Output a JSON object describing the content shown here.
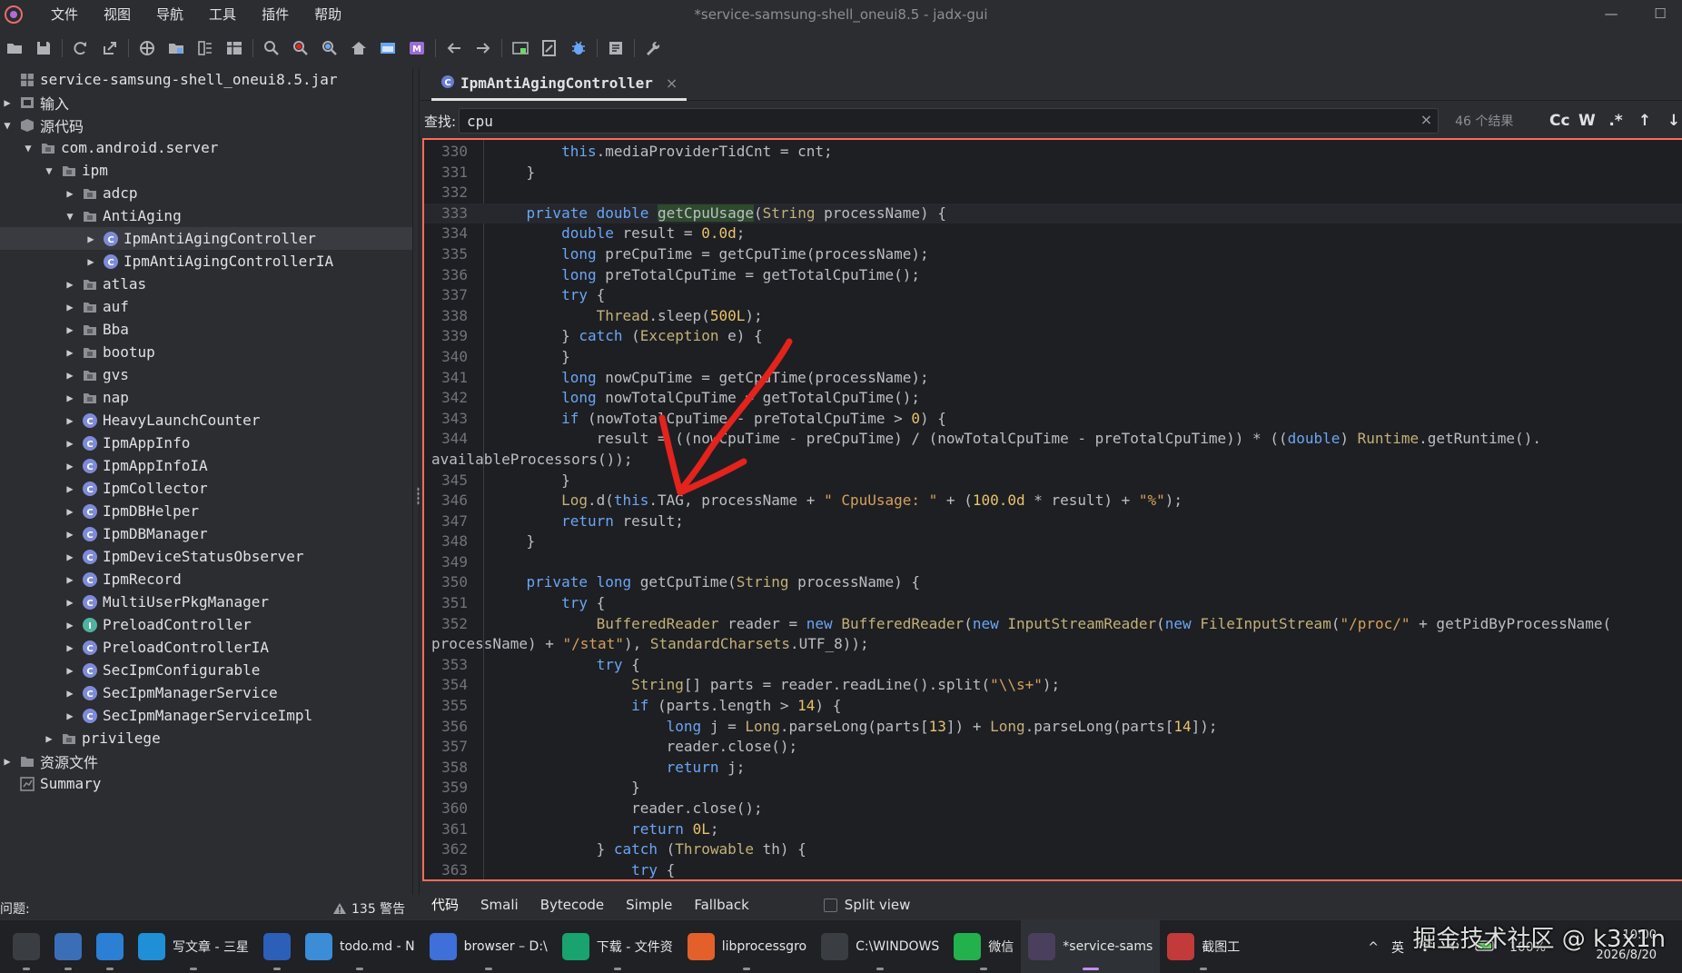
{
  "window": {
    "title": "*service-samsung-shell_oneui8.5 - jadx-gui",
    "menu": [
      "文件",
      "视图",
      "导航",
      "工具",
      "插件",
      "帮助"
    ],
    "minimize": "—",
    "maximize": "☐"
  },
  "toolbar": {
    "icons": [
      "open-icon",
      "save-icon",
      "reload-icon",
      "export-icon",
      "sync-icon",
      "folder-icon",
      "flatten-icon",
      "table-icon",
      "search-icon",
      "search-class-icon",
      "search-usage-icon",
      "home-icon",
      "window-icon",
      "bookmark-m-icon",
      "back-icon",
      "forward-icon",
      "deobfuscate-icon",
      "open-file-icon",
      "debug-icon",
      "log-icon",
      "settings-icon"
    ]
  },
  "tree": {
    "rows": [
      {
        "label": "service-samsung-shell_oneui8.5.jar",
        "depth": 0,
        "toggle": "",
        "icon": "jar-icon"
      },
      {
        "label": "输入",
        "depth": 0,
        "toggle": "▶",
        "icon": "input-icon"
      },
      {
        "label": "源代码",
        "depth": 0,
        "toggle": "▼",
        "icon": "source-icon"
      },
      {
        "label": "com.android.server",
        "depth": 1,
        "toggle": "▼",
        "icon": "package-icon"
      },
      {
        "label": "ipm",
        "depth": 2,
        "toggle": "▼",
        "icon": "package-icon"
      },
      {
        "label": "adcp",
        "depth": 3,
        "toggle": "▶",
        "icon": "package-icon"
      },
      {
        "label": "AntiAging",
        "depth": 3,
        "toggle": "▼",
        "icon": "package-icon"
      },
      {
        "label": "IpmAntiAgingController",
        "depth": 4,
        "toggle": "▶",
        "icon": "class-icon",
        "selected": true
      },
      {
        "label": "IpmAntiAgingControllerIA",
        "depth": 4,
        "toggle": "▶",
        "icon": "class-icon"
      },
      {
        "label": "atlas",
        "depth": 3,
        "toggle": "▶",
        "icon": "package-icon"
      },
      {
        "label": "auf",
        "depth": 3,
        "toggle": "▶",
        "icon": "package-icon"
      },
      {
        "label": "Bba",
        "depth": 3,
        "toggle": "▶",
        "icon": "package-icon"
      },
      {
        "label": "bootup",
        "depth": 3,
        "toggle": "▶",
        "icon": "package-icon"
      },
      {
        "label": "gvs",
        "depth": 3,
        "toggle": "▶",
        "icon": "package-icon"
      },
      {
        "label": "nap",
        "depth": 3,
        "toggle": "▶",
        "icon": "package-icon"
      },
      {
        "label": "HeavyLaunchCounter",
        "depth": 3,
        "toggle": "▶",
        "icon": "class-icon"
      },
      {
        "label": "IpmAppInfo",
        "depth": 3,
        "toggle": "▶",
        "icon": "class-icon"
      },
      {
        "label": "IpmAppInfoIA",
        "depth": 3,
        "toggle": "▶",
        "icon": "class-icon"
      },
      {
        "label": "IpmCollector",
        "depth": 3,
        "toggle": "▶",
        "icon": "class-icon"
      },
      {
        "label": "IpmDBHelper",
        "depth": 3,
        "toggle": "▶",
        "icon": "class-icon"
      },
      {
        "label": "IpmDBManager",
        "depth": 3,
        "toggle": "▶",
        "icon": "class-icon"
      },
      {
        "label": "IpmDeviceStatusObserver",
        "depth": 3,
        "toggle": "▶",
        "icon": "class-icon"
      },
      {
        "label": "IpmRecord",
        "depth": 3,
        "toggle": "▶",
        "icon": "class-icon"
      },
      {
        "label": "MultiUserPkgManager",
        "depth": 3,
        "toggle": "▶",
        "icon": "class-icon"
      },
      {
        "label": "PreloadController",
        "depth": 3,
        "toggle": "▶",
        "icon": "interface-icon"
      },
      {
        "label": "PreloadControllerIA",
        "depth": 3,
        "toggle": "▶",
        "icon": "class-icon"
      },
      {
        "label": "SecIpmConfigurable",
        "depth": 3,
        "toggle": "▶",
        "icon": "class-icon"
      },
      {
        "label": "SecIpmManagerService",
        "depth": 3,
        "toggle": "▶",
        "icon": "class-icon"
      },
      {
        "label": "SecIpmManagerServiceImpl",
        "depth": 3,
        "toggle": "▶",
        "icon": "class-icon"
      },
      {
        "label": "privilege",
        "depth": 2,
        "toggle": "▶",
        "icon": "package-icon"
      },
      {
        "label": "资源文件",
        "depth": 0,
        "toggle": "▶",
        "icon": "resources-icon"
      },
      {
        "label": "Summary",
        "depth": 0,
        "toggle": "",
        "icon": "summary-icon"
      }
    ]
  },
  "editor": {
    "tab_label": "IpmAntiAgingController",
    "tab_close": "×"
  },
  "search": {
    "label": "查找:",
    "value": "cpu",
    "clear": "×",
    "result_count": "46 个结果",
    "opt_case": "Cc",
    "opt_word": "W",
    "opt_regex": ".*",
    "prev": "↑",
    "next": "↓"
  },
  "code": {
    "lines": [
      {
        "n": "330",
        "t": "        <k>this</k>.mediaProviderTidCnt = cnt;"
      },
      {
        "n": "331",
        "t": "    }"
      },
      {
        "n": "332",
        "t": ""
      },
      {
        "n": "333",
        "t": "    <k>private</k> <k>double</k> <h>getCpuUsage</h>(<y>String</y> processName) {",
        "cur": true
      },
      {
        "n": "334",
        "t": "        <k>double</k> result = <m>0.0d</m>;"
      },
      {
        "n": "335",
        "t": "        <k>long</k> preCpuTime = getCpuTime(processName);"
      },
      {
        "n": "336",
        "t": "        <k>long</k> preTotalCpuTime = getTotalCpuTime();"
      },
      {
        "n": "337",
        "t": "        <k>try</k> {"
      },
      {
        "n": "338",
        "t": "            <y>Thread</y>.sleep(<m>500L</m>);"
      },
      {
        "n": "339",
        "t": "        } <k>catch</k> (<y>Exception</y> e) {"
      },
      {
        "n": "340",
        "t": "        }"
      },
      {
        "n": "341",
        "t": "        <k>long</k> nowCpuTime = getCpuTime(processName);"
      },
      {
        "n": "342",
        "t": "        <k>long</k> nowTotalCpuTime = getTotalCpuTime();"
      },
      {
        "n": "343",
        "t": "        <k>if</k> (nowTotalCpuTime - preTotalCpuTime > <m>0</m>) {"
      },
      {
        "n": "344",
        "t": "            result = ((nowCpuTime - preCpuTime) / (nowTotalCpuTime - preTotalCpuTime)) * ((<k>double</k>) <y>Runtime</y>.getRuntime()."
      },
      {
        "n": "",
        "t": "availableProcessors());",
        "wrap": true
      },
      {
        "n": "345",
        "t": "        }"
      },
      {
        "n": "346",
        "t": "        <y>Log</y>.d(<k>this</k>.TAG, processName + <s>\" CpuUsage: \"</s> + (<m>100.0d</m> * result) + <s>\"%\"</s>);"
      },
      {
        "n": "347",
        "t": "        <k>return</k> result;"
      },
      {
        "n": "348",
        "t": "    }"
      },
      {
        "n": "349",
        "t": ""
      },
      {
        "n": "350",
        "t": "    <k>private</k> <k>long</k> getCpuTime(<y>String</y> processName) {"
      },
      {
        "n": "351",
        "t": "        <k>try</k> {"
      },
      {
        "n": "352",
        "t": "            <y>BufferedReader</y> reader = <k>new</k> <y>BufferedReader</y>(<k>new</k> <y>InputStreamReader</y>(<k>new</k> <y>FileInputStream</y>(<s>\"/proc/\"</s> + getPidByProcessName("
      },
      {
        "n": "",
        "t": "processName) + <s>\"/stat\"</s>), <y>StandardCharsets</y>.UTF_8));",
        "wrap": true
      },
      {
        "n": "353",
        "t": "            <k>try</k> {"
      },
      {
        "n": "354",
        "t": "                <y>String</y>[] parts = reader.readLine().split(<s>\"\\\\s+\"</s>);"
      },
      {
        "n": "355",
        "t": "                <k>if</k> (parts.length > <m>14</m>) {"
      },
      {
        "n": "356",
        "t": "                    <k>long</k> j = <y>Long</y>.parseLong(parts[<m>13</m>]) + <y>Long</y>.parseLong(parts[<m>14</m>]);"
      },
      {
        "n": "357",
        "t": "                    reader.close();"
      },
      {
        "n": "358",
        "t": "                    <k>return</k> j;"
      },
      {
        "n": "359",
        "t": "                }"
      },
      {
        "n": "360",
        "t": "                reader.close();"
      },
      {
        "n": "361",
        "t": "                <k>return</k> <m>0L</m>;"
      },
      {
        "n": "362",
        "t": "            } <k>catch</k> (<y>Throwable</y> th) {"
      },
      {
        "n": "363",
        "t": "                <k>try</k> {"
      }
    ]
  },
  "view_tabs": [
    "代码",
    "Smali",
    "Bytecode",
    "Simple",
    "Fallback"
  ],
  "split_view_label": "Split view",
  "status": {
    "problems": "问题:",
    "warnings": "135 警告"
  },
  "taskbar": {
    "apps": [
      {
        "label": "",
        "icon": "file-explorer-icon",
        "color": "#3a3d42"
      },
      {
        "label": "",
        "icon": "calculator-icon",
        "color": "#3a6fb8"
      },
      {
        "label": "",
        "icon": "photos-icon",
        "color": "#2b7fd4"
      },
      {
        "label": "写文章 - 三星",
        "icon": "edge-icon",
        "color": "#1f8fd8"
      },
      {
        "label": "",
        "icon": "remote-desktop-icon",
        "color": "#2c5fb8"
      },
      {
        "label": "todo.md - N",
        "icon": "notepad-icon",
        "color": "#3a8dd6"
      },
      {
        "label": "browser – D:\\",
        "icon": "android-studio-icon",
        "color": "#3f6fd8"
      },
      {
        "label": "下载 - 文件资",
        "icon": "download-folder-icon",
        "color": "#18a36f"
      },
      {
        "label": "libprocessgro",
        "icon": "firefox-icon",
        "color": "#e3602a"
      },
      {
        "label": "C:\\WINDOWS",
        "icon": "terminal-icon",
        "color": "#3a3d42"
      },
      {
        "label": "微信",
        "icon": "wechat-icon",
        "color": "#22b14c"
      },
      {
        "label": "*service-sams",
        "icon": "jadx-icon",
        "color": "#4a3f5c",
        "active": true
      },
      {
        "label": "截图工",
        "icon": "screenshot-tool-icon",
        "color": "#c23a3a"
      }
    ],
    "tray": {
      "chevron": "^",
      "ime": "英",
      "battery": "100%",
      "time": "10:00",
      "date": "2026/8/20"
    }
  },
  "watermark": "掘金技术社区 @ k3x1n"
}
